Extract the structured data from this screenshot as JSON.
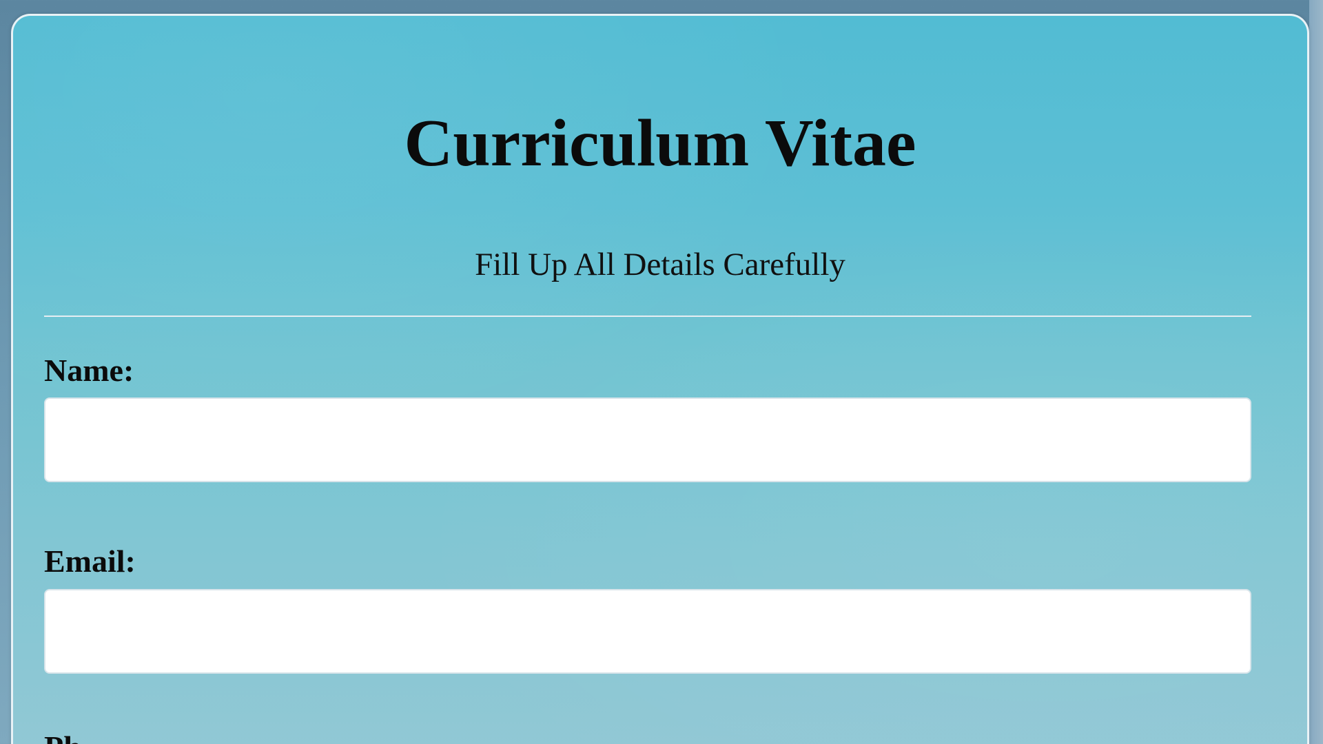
{
  "header": {
    "title": "Curriculum Vitae",
    "subtitle": "Fill Up All Details Carefully"
  },
  "form": {
    "fields": [
      {
        "label": "Name:",
        "value": "",
        "placeholder": ""
      },
      {
        "label": "Email:",
        "value": "",
        "placeholder": ""
      },
      {
        "label": "Ph",
        "value": "",
        "placeholder": ""
      }
    ]
  },
  "colors": {
    "card_top": "#52bcd3",
    "card_bottom": "#93c8d5",
    "text": "#0b0b0b",
    "input_background": "#ffffff"
  }
}
